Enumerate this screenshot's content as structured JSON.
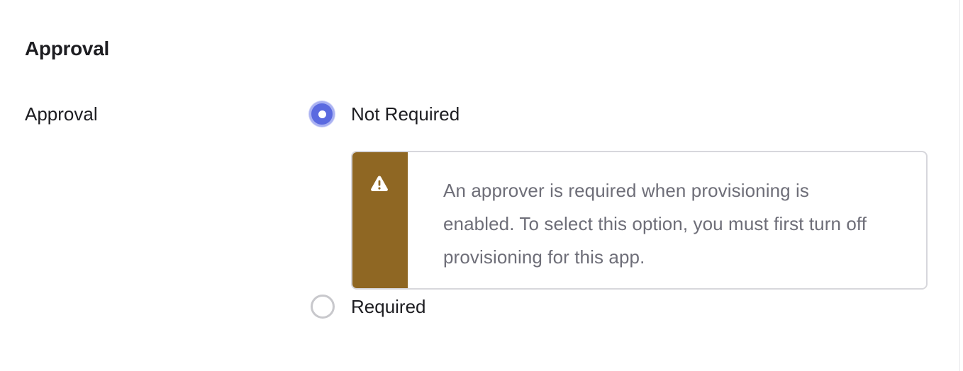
{
  "section": {
    "title": "Approval"
  },
  "field": {
    "label": "Approval"
  },
  "options": [
    {
      "label": "Not Required",
      "selected": true
    },
    {
      "label": "Required",
      "selected": false
    }
  ],
  "callout": {
    "icon": "warning-icon",
    "accent_color": "#8f6723",
    "message": "An approver is required when provisioning is enabled. To select this option, you must first turn off provisioning for this app."
  },
  "colors": {
    "radio_selected": "#5b6ae0"
  }
}
